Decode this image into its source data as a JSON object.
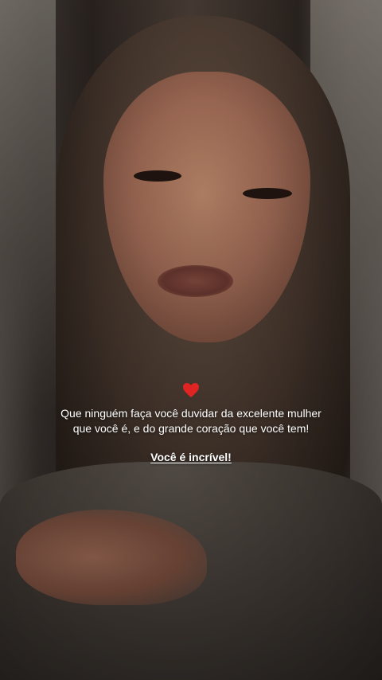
{
  "overlay": {
    "icon": "heart-icon",
    "icon_color": "#e02424",
    "message": "Que ninguém faça você duvidar da excelente mulher que você é, e do grande coração que você tem!",
    "cta": "Você é incrível!"
  },
  "colors": {
    "text": "#ffffff"
  }
}
